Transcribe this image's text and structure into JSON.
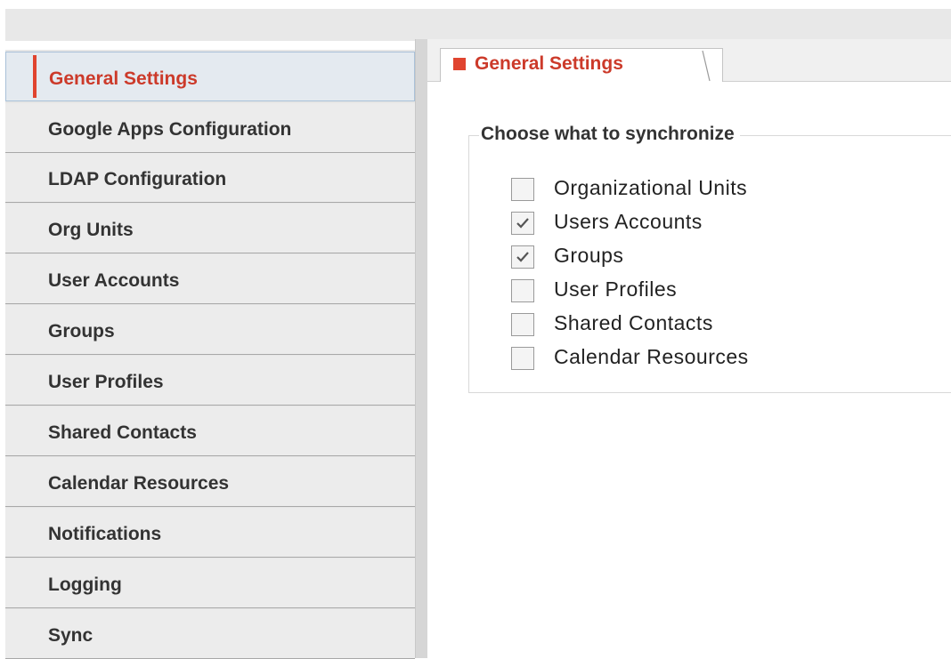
{
  "sidebar": {
    "items": [
      {
        "label": "General Settings",
        "active": true
      },
      {
        "label": "Google Apps Configuration",
        "active": false
      },
      {
        "label": "LDAP Configuration",
        "active": false
      },
      {
        "label": "Org Units",
        "active": false
      },
      {
        "label": "User Accounts",
        "active": false
      },
      {
        "label": "Groups",
        "active": false
      },
      {
        "label": "User Profiles",
        "active": false
      },
      {
        "label": "Shared Contacts",
        "active": false
      },
      {
        "label": "Calendar Resources",
        "active": false
      },
      {
        "label": "Notifications",
        "active": false
      },
      {
        "label": "Logging",
        "active": false
      },
      {
        "label": "Sync",
        "active": false
      }
    ]
  },
  "main": {
    "tab": {
      "label": "General Settings"
    },
    "section": {
      "title": "Choose what to synchronize",
      "options": [
        {
          "label": "Organizational Units",
          "checked": false
        },
        {
          "label": "Users Accounts",
          "checked": true
        },
        {
          "label": "Groups",
          "checked": true
        },
        {
          "label": "User Profiles",
          "checked": false
        },
        {
          "label": "Shared Contacts",
          "checked": false
        },
        {
          "label": "Calendar Resources",
          "checked": false
        }
      ]
    }
  },
  "colors": {
    "accent": "#e0442f",
    "active_text": "#cc3a2a",
    "sidebar_bg": "#ececec",
    "active_bg": "#e4eaf0"
  }
}
